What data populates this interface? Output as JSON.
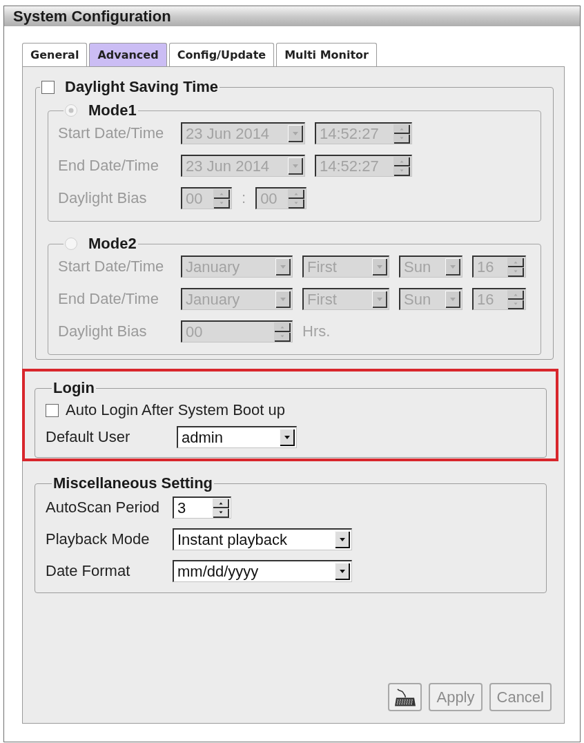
{
  "window": {
    "title": "System Configuration"
  },
  "tabs": [
    {
      "label": "General",
      "selected": false
    },
    {
      "label": "Advanced",
      "selected": true
    },
    {
      "label": "Config/Update",
      "selected": false
    },
    {
      "label": "Multi Monitor",
      "selected": false
    }
  ],
  "daylight_saving": {
    "label": "Daylight Saving Time",
    "checked": false,
    "modes": [
      {
        "label": "Mode1",
        "selected": true,
        "disabled": true,
        "rows": [
          {
            "label": "Start Date/Time",
            "fields": [
              {
                "kind": "combo",
                "value": "23 Jun 2014"
              },
              {
                "kind": "spin",
                "value": "14:52:27"
              }
            ]
          },
          {
            "label": "End Date/Time",
            "fields": [
              {
                "kind": "combo",
                "value": "23 Jun 2014"
              },
              {
                "kind": "spin",
                "value": "14:52:27"
              }
            ]
          },
          {
            "label": "Daylight Bias",
            "fields": [
              {
                "kind": "spin",
                "value": "00"
              },
              {
                "kind": "separator",
                "value": ":"
              },
              {
                "kind": "spin",
                "value": "00"
              }
            ]
          }
        ]
      },
      {
        "label": "Mode2",
        "selected": false,
        "disabled": true,
        "rows": [
          {
            "label": "Start Date/Time",
            "fields": [
              {
                "kind": "combo",
                "value": "January"
              },
              {
                "kind": "combo",
                "value": "First"
              },
              {
                "kind": "combo",
                "value": "Sun"
              },
              {
                "kind": "spin",
                "value": "16"
              }
            ]
          },
          {
            "label": "End Date/Time",
            "fields": [
              {
                "kind": "combo",
                "value": "January"
              },
              {
                "kind": "combo",
                "value": "First"
              },
              {
                "kind": "combo",
                "value": "Sun"
              },
              {
                "kind": "spin",
                "value": "16"
              }
            ]
          },
          {
            "label": "Daylight Bias",
            "fields": [
              {
                "kind": "spin",
                "value": "00"
              },
              {
                "kind": "unit",
                "value": "Hrs."
              }
            ]
          }
        ]
      }
    ]
  },
  "login": {
    "label": "Login",
    "highlighted": true,
    "auto_login": {
      "label": "Auto Login After System Boot up",
      "checked": false
    },
    "default_user": {
      "label": "Default User",
      "kind": "combo",
      "value": "admin"
    }
  },
  "misc": {
    "label": "Miscellaneous Setting",
    "rows": [
      {
        "label": "AutoScan Period",
        "kind": "spin",
        "value": "3"
      },
      {
        "label": "Playback Mode",
        "kind": "combo",
        "value": "Instant playback"
      },
      {
        "label": "Date Format",
        "kind": "combo",
        "value": "mm/dd/yyyy"
      }
    ]
  },
  "buttons": [
    {
      "kind": "keyboard",
      "disabled": false
    },
    {
      "kind": "text",
      "label": "Apply",
      "disabled": true
    },
    {
      "kind": "text",
      "label": "Cancel",
      "disabled": true
    }
  ]
}
